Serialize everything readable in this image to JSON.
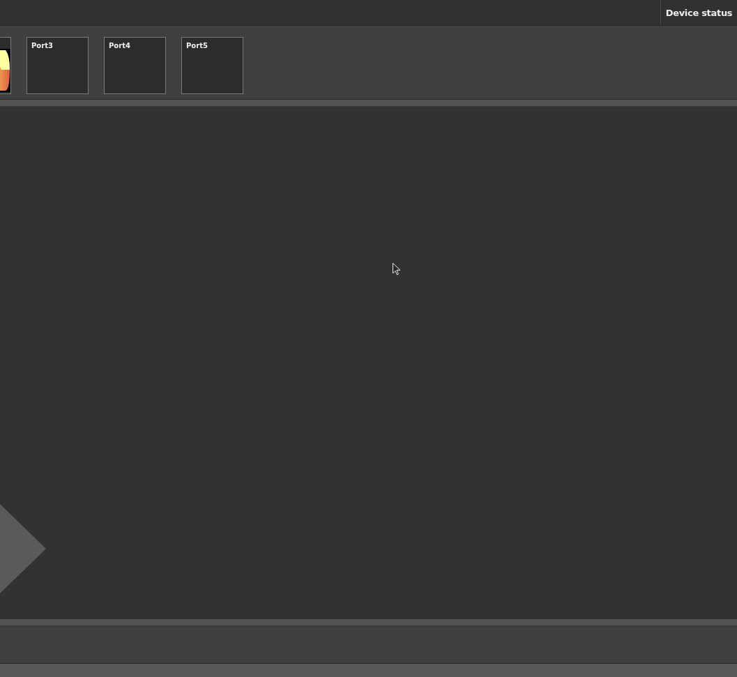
{
  "header": {
    "tabs": [
      {
        "label": "Device status",
        "selected": false
      }
    ]
  },
  "thumbnails": [
    {
      "kind": "picture"
    },
    {
      "kind": "port",
      "label": "Port3"
    },
    {
      "kind": "port",
      "label": "Port4"
    },
    {
      "kind": "port",
      "label": "Port5"
    }
  ]
}
